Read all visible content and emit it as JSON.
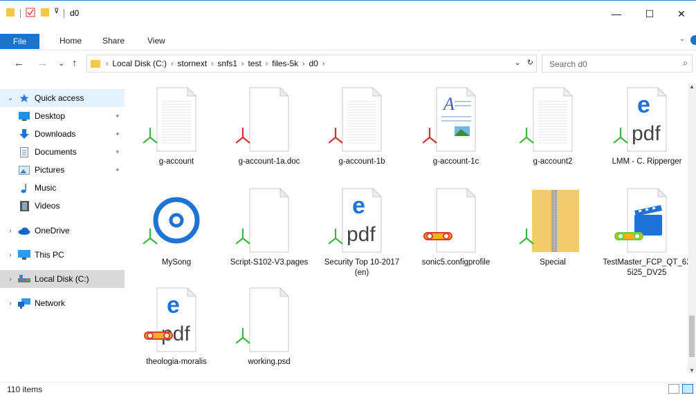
{
  "window": {
    "title": "d0",
    "minimize": "—",
    "maximize": "☐",
    "close": "✕"
  },
  "ribbon": {
    "tabs": [
      "File",
      "Home",
      "Share",
      "View"
    ],
    "expand": "⌄"
  },
  "nav": {
    "back": "←",
    "forward": "→",
    "recent": "⌄",
    "up": "↑",
    "breadcrumbs": [
      "Local Disk (C:)",
      "stornext",
      "snfs1",
      "test",
      "files-5k",
      "d0"
    ],
    "refresh": "↻",
    "dropdown": "⌄",
    "search_placeholder": "Search d0",
    "search_icon": "⌕"
  },
  "sidebar": {
    "items": [
      {
        "label": "Quick access",
        "icon": "star-icon",
        "chevron": "⌄",
        "pinned": false
      },
      {
        "label": "Desktop",
        "icon": "desktop-icon",
        "chevron": "",
        "pinned": true
      },
      {
        "label": "Downloads",
        "icon": "download-icon",
        "chevron": "",
        "pinned": true
      },
      {
        "label": "Documents",
        "icon": "documents-icon",
        "chevron": "",
        "pinned": true
      },
      {
        "label": "Pictures",
        "icon": "pictures-icon",
        "chevron": "",
        "pinned": true
      },
      {
        "label": "Music",
        "icon": "music-icon",
        "chevron": "",
        "pinned": false
      },
      {
        "label": "Videos",
        "icon": "videos-icon",
        "chevron": "",
        "pinned": false
      },
      {
        "label": "OneDrive",
        "icon": "cloud-icon",
        "chevron": "›",
        "pinned": false
      },
      {
        "label": "This PC",
        "icon": "pc-icon",
        "chevron": "›",
        "pinned": false
      },
      {
        "label": "Local Disk (C:)",
        "icon": "disk-icon",
        "chevron": "›",
        "pinned": false
      },
      {
        "label": "Network",
        "icon": "network-icon",
        "chevron": "›",
        "pinned": false
      }
    ],
    "pin_glyph": "📌"
  },
  "files": [
    {
      "name": "g-account",
      "type": "text",
      "badge": "green"
    },
    {
      "name": "g-account-1a.doc",
      "type": "blank",
      "badge": "red"
    },
    {
      "name": "g-account-1b",
      "type": "text",
      "badge": "red"
    },
    {
      "name": "g-account-1c",
      "type": "wordpad",
      "badge": "red"
    },
    {
      "name": "g-account2",
      "type": "text",
      "badge": "green"
    },
    {
      "name": "LMM - C. Ripperger",
      "type": "pdf",
      "badge": "green"
    },
    {
      "name": "MySong",
      "type": "groove",
      "badge": "green"
    },
    {
      "name": "Script-S102-V3.pages",
      "type": "blank",
      "badge": "green"
    },
    {
      "name": "Security Top 10-2017 (en)",
      "type": "pdf",
      "badge": "green"
    },
    {
      "name": "sonic5.configprofile",
      "type": "blank",
      "badge": "link-red"
    },
    {
      "name": "Special",
      "type": "zip",
      "badge": "green"
    },
    {
      "name": "TestMaster_FCP_QT_625i25_DV25",
      "type": "video",
      "badge": "link-green"
    },
    {
      "name": "theologia-moralis",
      "type": "pdf",
      "badge": "link-red"
    },
    {
      "name": "working.psd",
      "type": "blank",
      "badge": "green"
    }
  ],
  "status": {
    "count": "110 items"
  },
  "colors": {
    "accent": "#1a73c7",
    "selection": "#cce8ff",
    "folder": "#f5c84c",
    "badge_green": "#3cb43c",
    "badge_red": "#d62f2f"
  }
}
